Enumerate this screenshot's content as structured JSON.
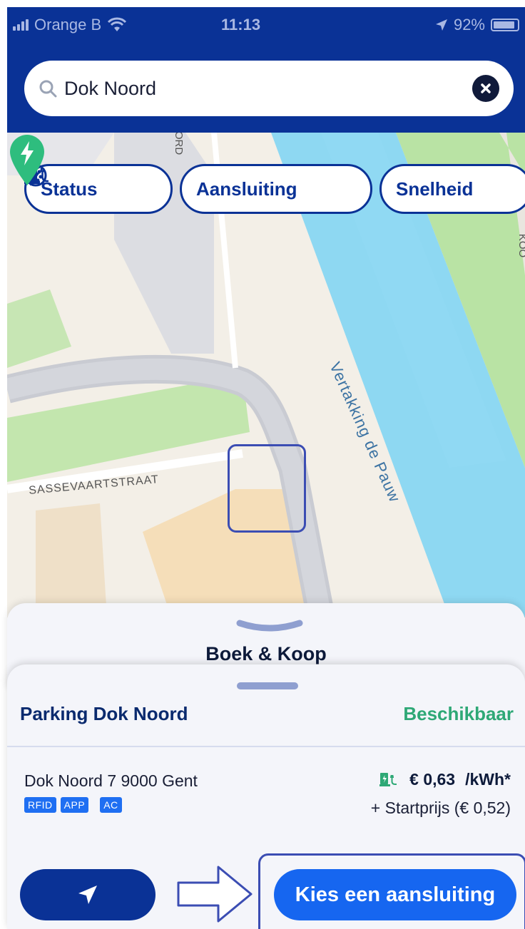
{
  "status_bar": {
    "carrier": "Orange B",
    "time": "11:13",
    "battery": "92%"
  },
  "search": {
    "value": "Dok Noord"
  },
  "filters": [
    {
      "label": "Status",
      "icon": "charger-icon"
    },
    {
      "label": "Aansluiting",
      "icon": "plug-connector-icon"
    },
    {
      "label": "Snelheid",
      "icon": "lightning-icon"
    }
  ],
  "map": {
    "river_label": "Vertakking de Pauw",
    "street_label": "SASSEVAARTSTRAAT",
    "street_fragment_top": "ORD",
    "street_fragment_right": "KOO",
    "marker_icon": "charging-station-marker-icon"
  },
  "sheet_back": {
    "title": "Boek & Koop"
  },
  "station": {
    "name": "Parking Dok Noord",
    "availability": "Beschikbaar",
    "address": "Dok Noord 7 9000 Gent",
    "tags": [
      "RFID",
      "APP",
      "AC"
    ],
    "price": "€ 0,63",
    "price_unit": "/kWh*",
    "start_price": "+ Startprijs (€ 0,52)"
  },
  "actions": {
    "navigate_icon": "navigation-arrow-icon",
    "choose_connector_label": "Kies een aansluiting"
  },
  "colors": {
    "brand": "#0a3296",
    "accent": "#1666f0",
    "available": "#2ea876",
    "river": "#8ed8f2",
    "park": "#b9e3a4"
  }
}
